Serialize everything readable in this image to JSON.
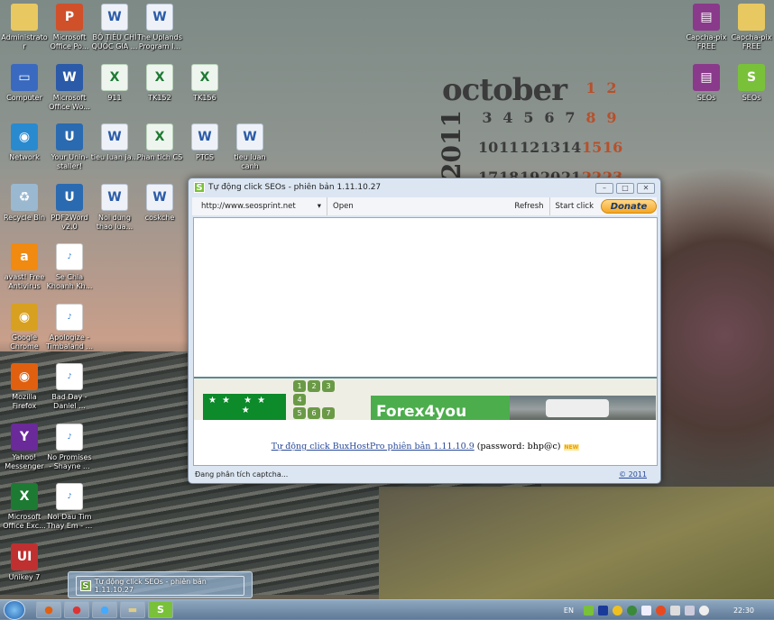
{
  "desktop_icons": [
    {
      "label": "Administrato r",
      "type": "folder"
    },
    {
      "label": "Microsoft Office Po...",
      "type": "ppt"
    },
    {
      "label": "BỘ TIÊU CHÍ QUỐC GIA ...",
      "type": "doc"
    },
    {
      "label": "The Uplands Program I...",
      "type": "doc"
    },
    {
      "label": "Computer",
      "type": "computer"
    },
    {
      "label": "Microsoft Office Wo...",
      "type": "word"
    },
    {
      "label": "911",
      "type": "xls"
    },
    {
      "label": "TK152",
      "type": "xls"
    },
    {
      "label": "TK156",
      "type": "xls"
    },
    {
      "label": "Network",
      "type": "network"
    },
    {
      "label": "Your Unin-staller!",
      "type": "app"
    },
    {
      "label": "tieu luan ja...",
      "type": "doc"
    },
    {
      "label": "Phan tich CS",
      "type": "xls"
    },
    {
      "label": "PTCS",
      "type": "doc"
    },
    {
      "label": "tieu luan canh",
      "type": "doc"
    },
    {
      "label": "Recycle Bin",
      "type": "bin"
    },
    {
      "label": "PDF2Word v2.0",
      "type": "app"
    },
    {
      "label": "Noi dung thao lua...",
      "type": "doc"
    },
    {
      "label": "coskche",
      "type": "doc"
    },
    {
      "label": "avast! Free Antivirus",
      "type": "avast"
    },
    {
      "label": "Se Chia Khoanh Kh...",
      "type": "mp3"
    },
    {
      "label": "Google Chrome",
      "type": "chrome"
    },
    {
      "label": "Apologize - Timbaland ...",
      "type": "mp3"
    },
    {
      "label": "Mozilla Firefox",
      "type": "firefox"
    },
    {
      "label": "Bad Day - Daniel ...",
      "type": "mp3"
    },
    {
      "label": "Yahoo! Messenger",
      "type": "yahoo"
    },
    {
      "label": "No Promises - Shayne ...",
      "type": "mp3"
    },
    {
      "label": "Microsoft Office Exc...",
      "type": "excel"
    },
    {
      "label": "Noi Dau Tim Thay Em - ...",
      "type": "mp3"
    },
    {
      "label": "Unikey 7",
      "type": "unikey"
    },
    {
      "label": "Capcha-pix FREE",
      "type": "rar"
    },
    {
      "label": "Capcha-pix FREE",
      "type": "folder"
    },
    {
      "label": "SEOs",
      "type": "rar"
    },
    {
      "label": "SEOs",
      "type": "seos"
    }
  ],
  "calendar": {
    "month": "october",
    "year": "2011",
    "days": [
      "1",
      "2",
      "3",
      "4",
      "5",
      "6",
      "7",
      "8",
      "9",
      "10",
      "11",
      "12",
      "13",
      "14",
      "15",
      "16",
      "17",
      "18",
      "19",
      "20",
      "21",
      "22",
      "23"
    ]
  },
  "window": {
    "title": "Tự động click SEOs - phiên bản 1.11.10.27",
    "url": "http://www.seosprint.net",
    "open": "Open",
    "refresh": "Refresh",
    "start": "Start click",
    "donate": "Donate",
    "pager": [
      "1",
      "2",
      "3",
      "4",
      "5",
      "6",
      "7"
    ],
    "ad_text": "Forex4you",
    "link": "Tự động click BuxHostPro phiên bản 1.11.10.9",
    "password": "(password: bhp@c)",
    "new_badge": "NEW",
    "status": "Đang phân tích captcha...",
    "copyright": "© 2011"
  },
  "taskbar": {
    "preview_title": "Tự động click SEOs - phiên bản 1.11.10.27",
    "lang": "EN",
    "clock": "22:30"
  }
}
